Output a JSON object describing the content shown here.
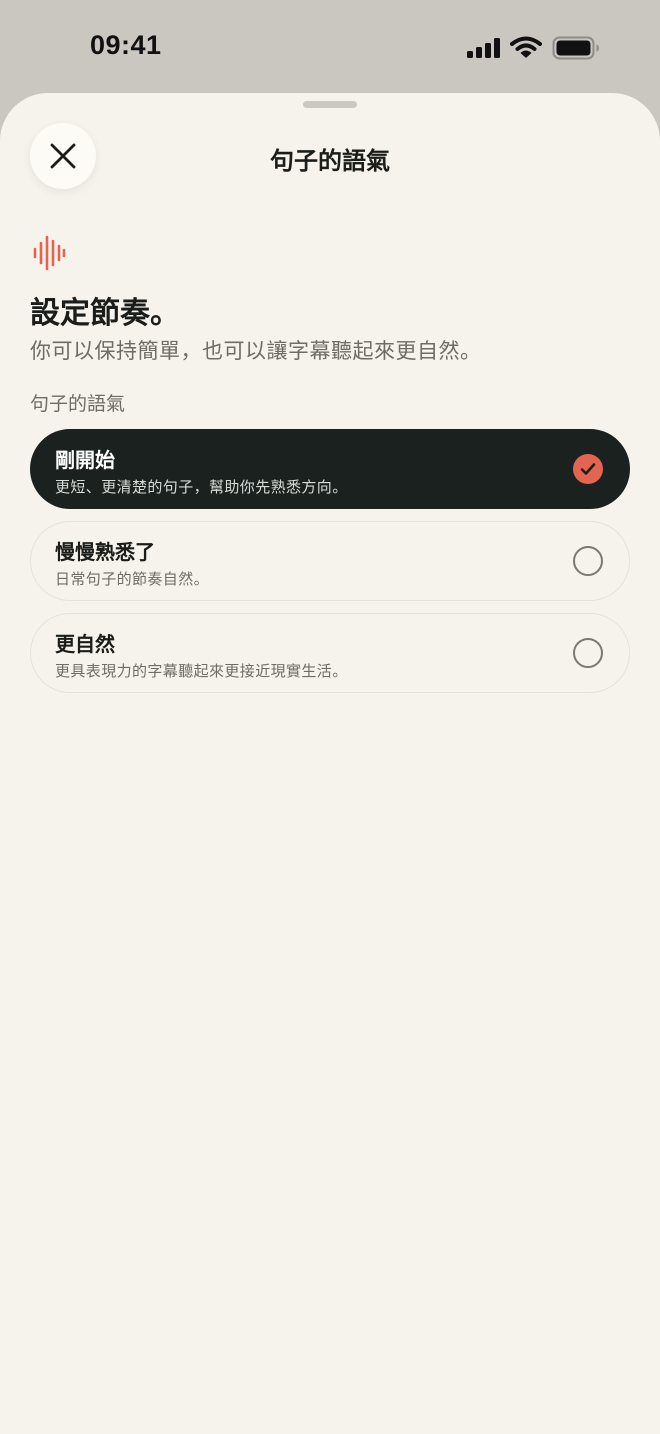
{
  "status_bar": {
    "time": "09:41"
  },
  "sheet": {
    "title": "句子的語氣"
  },
  "intro": {
    "heading": "設定節奏。",
    "subheading": "你可以保持簡單，也可以讓字幕聽起來更自然。"
  },
  "section": {
    "label": "句子的語氣",
    "options": [
      {
        "title": "剛開始",
        "description": "更短、更清楚的句子，幫助你先熟悉方向。",
        "selected": true
      },
      {
        "title": "慢慢熟悉了",
        "description": "日常句子的節奏自然。",
        "selected": false
      },
      {
        "title": "更自然",
        "description": "更具表現力的字幕聽起來更接近現實生活。",
        "selected": false
      }
    ]
  },
  "colors": {
    "accent": "#e36551",
    "selected_background": "#1a211e",
    "sheet_background": "#f6f3ec",
    "backdrop": "#cac7c0"
  },
  "icons": {
    "close": "close-icon",
    "wave": "sound-wave-icon",
    "check": "checkmark-icon",
    "signal": "cellular-signal-icon",
    "wifi": "wifi-icon",
    "battery": "battery-icon"
  }
}
